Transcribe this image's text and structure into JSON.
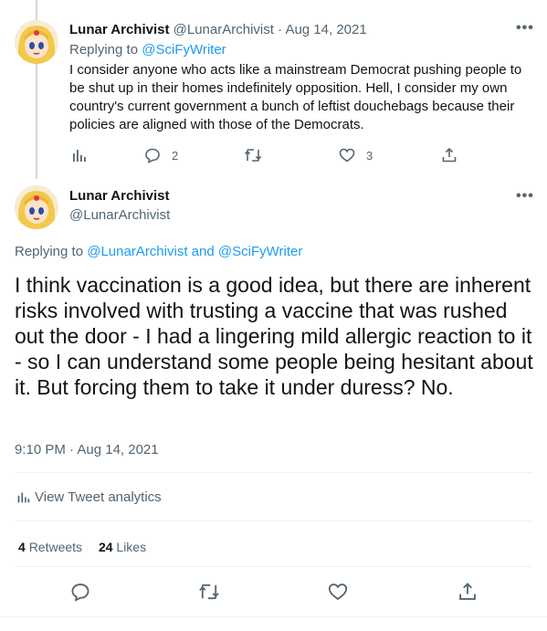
{
  "parent_tweet": {
    "display_name": "Lunar Archivist",
    "handle": "@LunarArchivist",
    "separator": "·",
    "date": "Aug 14, 2021",
    "replying_label": "Replying to",
    "replying_to": "@SciFyWriter",
    "text": "I consider anyone who acts like a mainstream Democrat pushing people to be shut up in their homes indefinitely opposition. Hell, I consider my own country's current government a bunch of leftist douchebags because their policies are aligned with those of the Democrats.",
    "reply_count": "2",
    "like_count": "3"
  },
  "main_tweet": {
    "display_name": "Lunar Archivist",
    "handle": "@LunarArchivist",
    "replying_label": "Replying to",
    "replying_to_1": "@LunarArchivist",
    "replying_and": "and",
    "replying_to_2": "@SciFyWriter",
    "text": "I think vaccination is a good idea, but there are inherent risks involved with trusting a vaccine that was rushed out the door - I had a lingering mild allergic reaction to it - so I can understand some people being hesitant about it. But forcing them to take it under duress? No.",
    "timestamp": "9:10 PM · Aug 14, 2021",
    "analytics_label": "View Tweet analytics",
    "retweets_count": "4",
    "retweets_label": "Retweets",
    "likes_count": "24",
    "likes_label": "Likes"
  },
  "colors": {
    "accent": "#1d9bf0",
    "muted": "#536471",
    "divider": "#eff3f4"
  },
  "icons": {
    "analytics": "bar-chart-icon",
    "reply": "reply-icon",
    "retweet": "retweet-icon",
    "like": "heart-icon",
    "share": "share-icon",
    "more": "more-icon"
  }
}
